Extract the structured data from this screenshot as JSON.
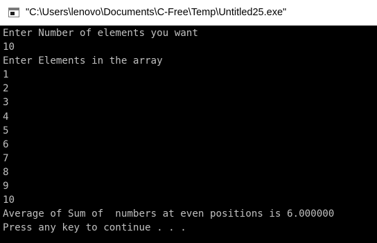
{
  "window": {
    "title": "\"C:\\Users\\lenovo\\Documents\\C-Free\\Temp\\Untitled25.exe\"",
    "icon": "console-window-icon"
  },
  "console": {
    "lines": [
      "Enter Number of elements you want",
      "10",
      "Enter Elements in the array",
      "1",
      "2",
      "3",
      "4",
      "5",
      "6",
      "7",
      "8",
      "9",
      "10",
      "Average of Sum of  numbers at even positions is 6.000000",
      "Press any key to continue . . ."
    ]
  },
  "colors": {
    "titlebar_bg": "#ffffff",
    "console_bg": "#000000",
    "console_text": "#c0c0c0"
  }
}
